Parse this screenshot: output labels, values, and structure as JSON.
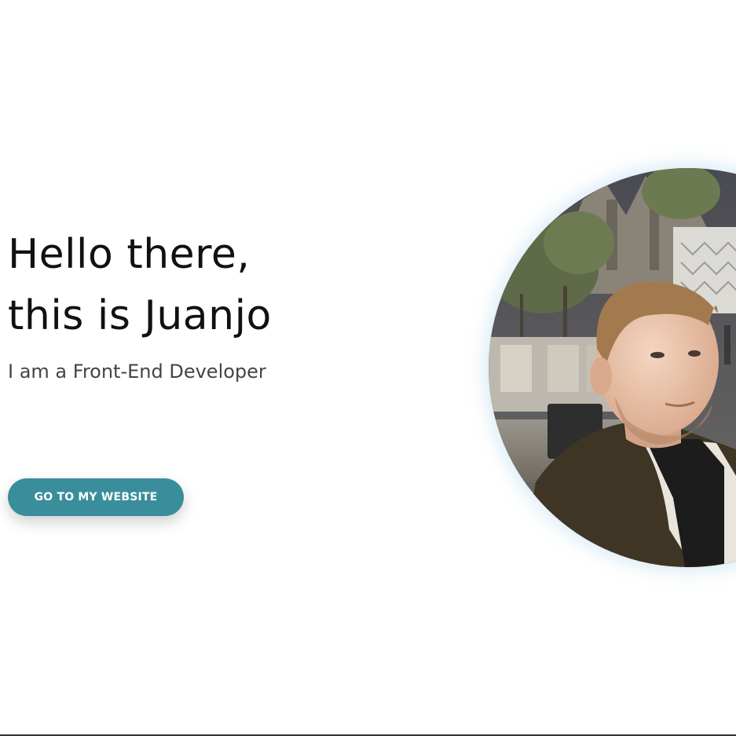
{
  "hero": {
    "headline_line1": "Hello there,",
    "headline_line2": "this is Juanjo",
    "subtitle": "I am a Front-End Developer",
    "cta_label": "GO TO MY WEBSITE"
  },
  "colors": {
    "accent": "#3a8e9c",
    "headline": "#111111",
    "subtitle": "#444444",
    "background": "#ffffff"
  },
  "avatar": {
    "icon": "profile-photo"
  }
}
